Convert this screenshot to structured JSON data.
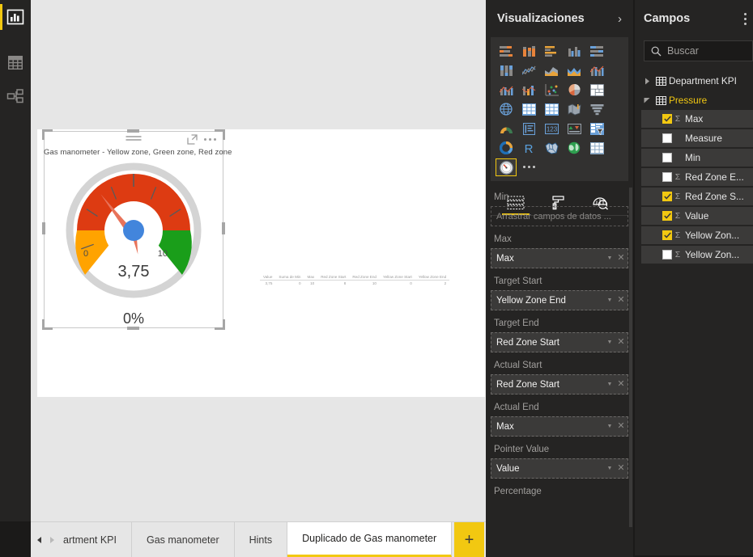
{
  "left_rail": {
    "items": [
      {
        "name": "report-view",
        "icon": "bar-chart-icon",
        "active": true
      },
      {
        "name": "data-view",
        "icon": "table-icon",
        "active": false
      },
      {
        "name": "model-view",
        "icon": "relationships-icon",
        "active": false
      }
    ]
  },
  "canvas": {
    "visual": {
      "title": "Gas manometer - Yellow zone, Green zone, Red zone",
      "value_label": "3,75",
      "percent_label": "0%",
      "axis_min_label": "0",
      "axis_max_label": "10",
      "header": {
        "drag_handle": "drag-handle-icon",
        "focus_mode": "focus-mode-icon",
        "more_options": "more-options-icon"
      }
    },
    "data_table": {
      "headers": [
        "Value",
        "Suma de Min",
        "Max",
        "Red Zone Start",
        "Red Zone End",
        "Yellow Zone Start",
        "Yellow Zone End"
      ],
      "rows": [
        [
          "3,75",
          "0",
          "10",
          "8",
          "10",
          "0",
          "2"
        ]
      ]
    }
  },
  "chart_data": {
    "type": "gauge",
    "title": "Gas manometer - Yellow zone, Green zone, Red zone",
    "pointer_value": 3.75,
    "value_display": "3,75",
    "percent_display": "0%",
    "min": 0,
    "max": 10,
    "min_label": "0",
    "max_label": "10",
    "bands": [
      {
        "name": "Yellow zone",
        "from": 0,
        "to": 2,
        "color": "#FFA300"
      },
      {
        "name": "Red zone",
        "from": 2,
        "to": 8,
        "color": "#DD3B12"
      },
      {
        "name": "Green zone",
        "from": 8,
        "to": 10,
        "color": "#1A9E1A"
      }
    ],
    "needle_color": "#E8735A",
    "hub_color": "#4285DC",
    "dial_ring_color": "#D0D0D0"
  },
  "tabbar": {
    "nav_prev": "prev-page-arrow",
    "nav_next": "next-page-arrow",
    "tabs": [
      {
        "label": "artment KPI",
        "active": false,
        "clipped": true
      },
      {
        "label": "Gas manometer",
        "active": false,
        "clipped": false
      },
      {
        "label": "Hints",
        "active": false,
        "clipped": false
      },
      {
        "label": "Duplicado de Gas manometer",
        "active": true,
        "clipped": false
      }
    ],
    "add_label": "+"
  },
  "visualizations": {
    "title": "Visualizaciones",
    "collapse_icon": "chevron-right-icon",
    "gallery": [
      {
        "name": "stacked-bar-chart"
      },
      {
        "name": "stacked-column-chart"
      },
      {
        "name": "clustered-bar-chart"
      },
      {
        "name": "clustered-column-chart"
      },
      {
        "name": "100-stacked-bar-chart"
      },
      {
        "name": "100-stacked-column-chart"
      },
      {
        "name": "line-chart"
      },
      {
        "name": "area-chart"
      },
      {
        "name": "stacked-area-chart"
      },
      {
        "name": "line-stacked-column-chart"
      },
      {
        "name": "line-clustered-column-chart"
      },
      {
        "name": "ribbon-chart"
      },
      {
        "name": "scatter-chart"
      },
      {
        "name": "pie-chart"
      },
      {
        "name": "treemap"
      },
      {
        "name": "map"
      },
      {
        "name": "matrix"
      },
      {
        "name": "table"
      },
      {
        "name": "filled-map"
      },
      {
        "name": "funnel-chart"
      },
      {
        "name": "gauge-chart"
      },
      {
        "name": "multi-row-card"
      },
      {
        "name": "card"
      },
      {
        "name": "kpi"
      },
      {
        "name": "slicer"
      },
      {
        "name": "donut-chart"
      },
      {
        "name": "r-script-visual"
      },
      {
        "name": "shape-map"
      },
      {
        "name": "arcgis-map"
      },
      {
        "name": "custom-table-visual"
      },
      {
        "name": "custom-gauge-visual",
        "selected": true
      }
    ],
    "more_visuals": "more-visuals-icon",
    "well_tabs": [
      {
        "name": "fields-tab",
        "icon": "fields-icon",
        "active": true
      },
      {
        "name": "format-tab",
        "icon": "paint-roller-icon",
        "active": false
      },
      {
        "name": "analytics-tab",
        "icon": "analytics-magnifier-icon",
        "active": false
      }
    ],
    "wells": [
      {
        "label": "Min",
        "value": null,
        "placeholder": "Arrastrar campos de datos ..."
      },
      {
        "label": "Max",
        "value": "Max",
        "placeholder": null
      },
      {
        "label": "Target Start",
        "value": "Yellow Zone End",
        "placeholder": null
      },
      {
        "label": "Target End",
        "value": "Red Zone Start",
        "placeholder": null
      },
      {
        "label": "Actual Start",
        "value": "Red Zone Start",
        "placeholder": null
      },
      {
        "label": "Actual End",
        "value": "Max",
        "placeholder": null
      },
      {
        "label": "Pointer Value",
        "value": "Value",
        "placeholder": null
      },
      {
        "label": "Percentage",
        "value": null,
        "placeholder": null
      }
    ]
  },
  "fields": {
    "title": "Campos",
    "more_icon": "more-options-icon",
    "search": {
      "placeholder": "Buscar",
      "value": "",
      "icon": "search-icon"
    },
    "tables": [
      {
        "name": "Department KPI",
        "expanded": false,
        "icon": "table-icon",
        "fields": []
      },
      {
        "name": "Pressure",
        "expanded": true,
        "icon": "table-icon",
        "fields": [
          {
            "label": "Max",
            "checked": true,
            "aggregate": true
          },
          {
            "label": "Measure",
            "checked": false,
            "aggregate": false
          },
          {
            "label": "Min",
            "checked": false,
            "aggregate": false
          },
          {
            "label": "Red Zone E...",
            "checked": false,
            "aggregate": true
          },
          {
            "label": "Red Zone S...",
            "checked": true,
            "aggregate": true
          },
          {
            "label": "Value",
            "checked": true,
            "aggregate": true
          },
          {
            "label": "Yellow Zon...",
            "checked": true,
            "aggregate": true
          },
          {
            "label": "Yellow Zon...",
            "checked": false,
            "aggregate": true
          }
        ]
      }
    ]
  },
  "colors": {
    "accent": "#f2c811",
    "pane_bg": "#252423",
    "canvas_bg": "#e6e6e6",
    "red": "#DD3B12",
    "orange": "#FFA300",
    "green": "#1A9E1A"
  }
}
